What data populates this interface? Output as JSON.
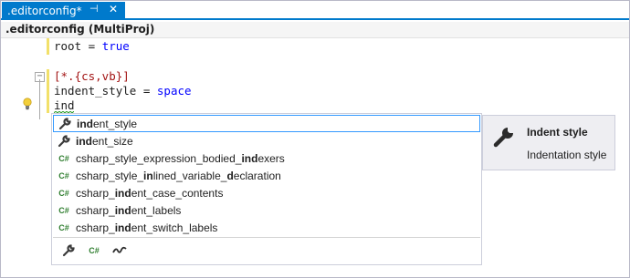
{
  "tab": {
    "title": ".editorconfig*",
    "pin_glyph": "⊣",
    "close_glyph": "✕"
  },
  "navbar": {
    "label": ".editorconfig (MultiProj)"
  },
  "code": {
    "line1_key": "root = ",
    "line1_value": "true",
    "line2_section": "[*.{cs,vb}]",
    "line3_key": "indent_style = ",
    "line3_value": "space",
    "line4_typed": "ind"
  },
  "completion": {
    "items": [
      {
        "icon": "wrench-icon",
        "pre": "",
        "match": "ind",
        "post": "ent_style"
      },
      {
        "icon": "wrench-icon",
        "pre": "",
        "match": "ind",
        "post": "ent_size"
      },
      {
        "icon": "csharp-icon",
        "pre": "csharp_style_expression_bodied_",
        "match": "ind",
        "post": "exers"
      },
      {
        "icon": "csharp-icon",
        "pre": "csharp_style_",
        "match": "in",
        "post": "lined_variable_",
        "match2": "d",
        "post2": "eclaration"
      },
      {
        "icon": "csharp-icon",
        "pre": "csharp_",
        "match": "ind",
        "post": "ent_case_contents"
      },
      {
        "icon": "csharp-icon",
        "pre": "csharp_",
        "match": "ind",
        "post": "ent_labels"
      },
      {
        "icon": "csharp-icon",
        "pre": "csharp_",
        "match": "ind",
        "post": "ent_switch_labels"
      }
    ],
    "cs_glyph": "C#",
    "filters": [
      "wrench-icon",
      "csharp-icon",
      "vb-icon"
    ]
  },
  "quickinfo": {
    "title": "Indent style",
    "description": "Indentation style"
  },
  "colors": {
    "accent": "#007acc",
    "keyword": "#0000ff",
    "section": "#a31515",
    "modified_margin": "#f2e06a",
    "selection_border": "#3399ff"
  }
}
